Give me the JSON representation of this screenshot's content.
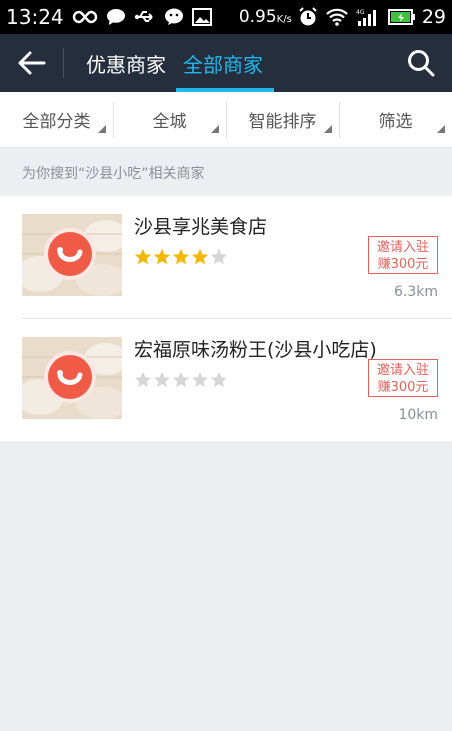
{
  "status_bar": {
    "time": "13:24",
    "network_speed": "0.95",
    "network_unit": "K/s",
    "battery_level": "29",
    "icons": [
      "infinity-icon",
      "chat-bubble-icon",
      "usb-icon",
      "wechat-icon",
      "image-icon",
      "alarm-icon",
      "wifi-icon",
      "signal-4g-icon",
      "battery-icon"
    ]
  },
  "nav": {
    "tab_offers": "优惠商家",
    "tab_all": "全部商家",
    "active_tab": "tab_all",
    "accent_color": "#21b8ef",
    "background_color": "#252e3d"
  },
  "filters": {
    "category": "全部分类",
    "city": "全城",
    "sort": "智能排序",
    "filter": "筛选"
  },
  "results": {
    "caption": "为你搜到“沙县小吃”相关商家"
  },
  "merchants": [
    {
      "name": "沙县享兆美食店",
      "rating": 4,
      "max_rating": 5,
      "invite_line1": "邀请入驻",
      "invite_line2": "赚300元",
      "distance": "6.3km"
    },
    {
      "name": "宏福原味汤粉王(沙县小吃店)",
      "rating": 0,
      "max_rating": 5,
      "invite_line1": "邀请入驻",
      "invite_line2": "赚300元",
      "distance": "10km"
    }
  ],
  "colors": {
    "star_filled": "#f5b800",
    "star_empty": "#d6d6d6",
    "invite_red": "#e0625b",
    "logo_red": "#ef5b46"
  }
}
